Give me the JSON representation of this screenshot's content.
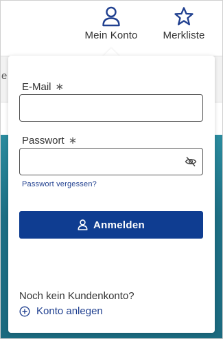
{
  "header": {
    "account_label": "Mein Konto",
    "wishlist_label": "Merkliste",
    "account_icon": "user-icon",
    "wishlist_icon": "star-icon"
  },
  "background": {
    "edge_text": "e"
  },
  "login": {
    "email_label": "E-Mail",
    "email_required": "∗",
    "email_value": "",
    "password_label": "Passwort",
    "password_required": "∗",
    "password_value": "",
    "toggle_icon": "eye-slash-icon",
    "forgot_label": "Passwort vergessen?",
    "submit_label": "Anmelden"
  },
  "register": {
    "prompt": "Noch kein Kundenkonto?",
    "create_label": "Konto anlegen",
    "create_icon": "plus-circle-icon"
  },
  "colors": {
    "brand": "#0f3d91",
    "link": "#1f3f8f",
    "teal_background": "#1d6f84"
  }
}
